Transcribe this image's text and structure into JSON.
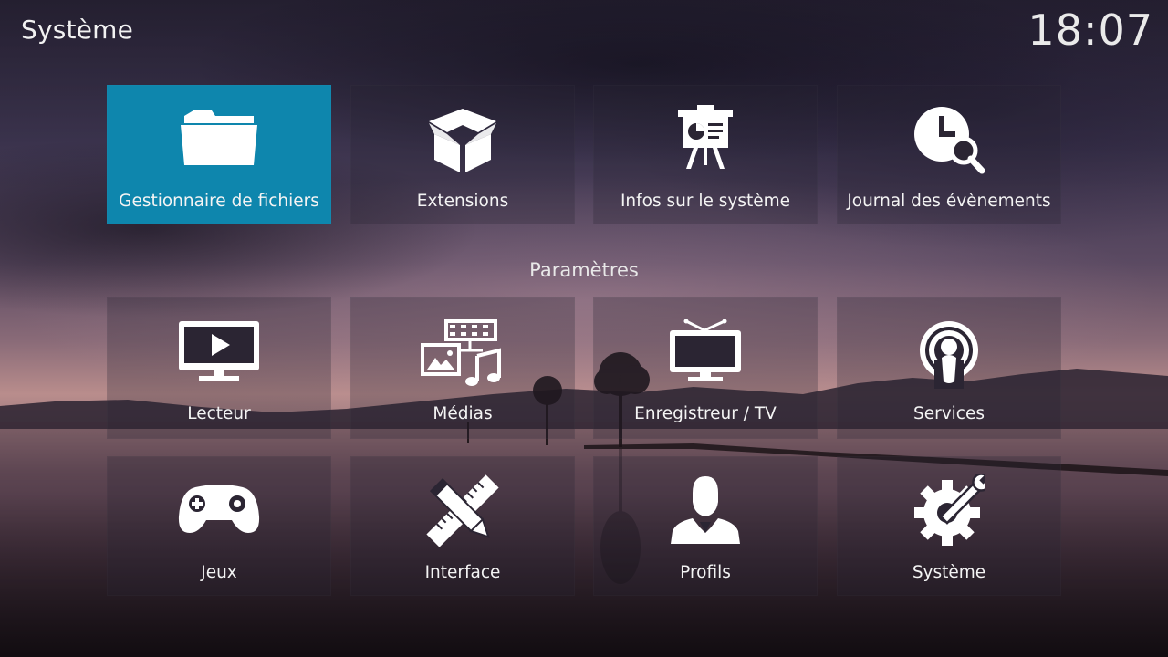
{
  "header": {
    "title": "Système",
    "clock": "18:07"
  },
  "top_tiles": [
    {
      "label": "Gestionnaire de fichiers",
      "icon": "folder-icon",
      "focused": true
    },
    {
      "label": "Extensions",
      "icon": "box-icon"
    },
    {
      "label": "Infos sur le système",
      "icon": "presentation-icon"
    },
    {
      "label": "Journal des évènements",
      "icon": "clock-search-icon"
    }
  ],
  "section": {
    "label": "Paramètres"
  },
  "settings_tiles": [
    {
      "label": "Lecteur",
      "icon": "monitor-play-icon"
    },
    {
      "label": "Médias",
      "icon": "media-icon"
    },
    {
      "label": "Enregistreur / TV",
      "icon": "tv-icon"
    },
    {
      "label": "Services",
      "icon": "broadcast-icon"
    },
    {
      "label": "Jeux",
      "icon": "gamepad-icon"
    },
    {
      "label": "Interface",
      "icon": "pencil-ruler-icon"
    },
    {
      "label": "Profils",
      "icon": "user-icon"
    },
    {
      "label": "Système",
      "icon": "gear-wrench-icon"
    }
  ],
  "colors": {
    "focus": "#0e86ad",
    "text": "#ffffff"
  }
}
